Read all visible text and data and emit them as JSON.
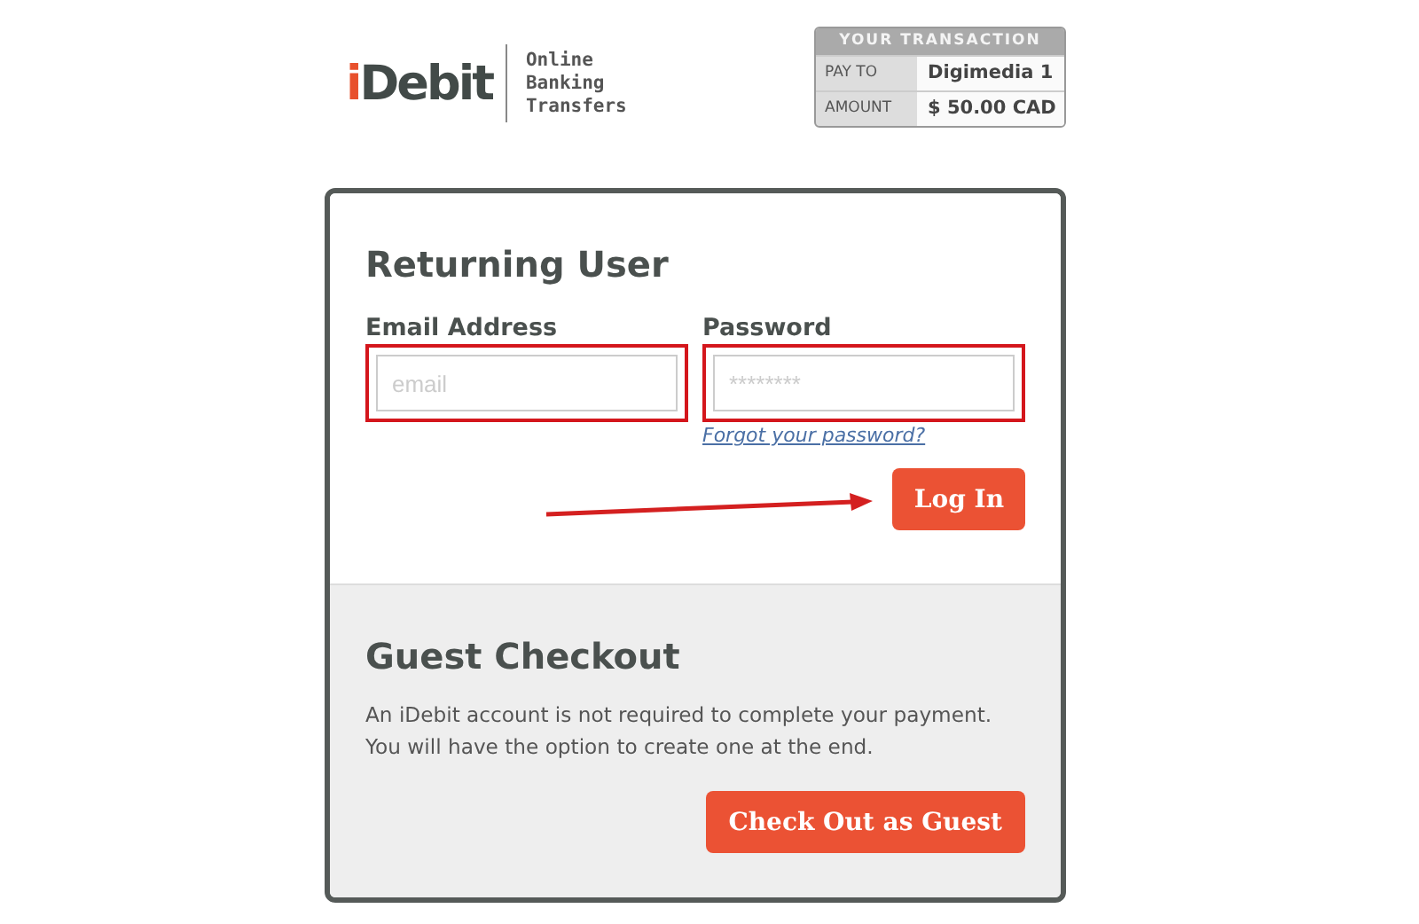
{
  "logo": {
    "accent": "i",
    "rest": "Debit",
    "tagline": [
      "Online",
      "Banking",
      "Transfers"
    ]
  },
  "transaction": {
    "title": "YOUR TRANSACTION",
    "rows": [
      {
        "label": "PAY TO",
        "value": "Digimedia 1"
      },
      {
        "label": "AMOUNT",
        "value": "$ 50.00 CAD"
      }
    ]
  },
  "returning_user": {
    "title": "Returning User",
    "fields": [
      {
        "label": "Email Address",
        "placeholder": "email",
        "highlighted": true
      },
      {
        "label": "Password",
        "placeholder": "********",
        "highlighted": true
      }
    ],
    "forgot_link": "Forgot your password?",
    "login_button": "Log In"
  },
  "guest_checkout": {
    "title": "Guest Checkout",
    "text": "An iDebit account is not required to complete your payment. You will have the option to create one at the end.",
    "button": "Check Out as Guest"
  }
}
